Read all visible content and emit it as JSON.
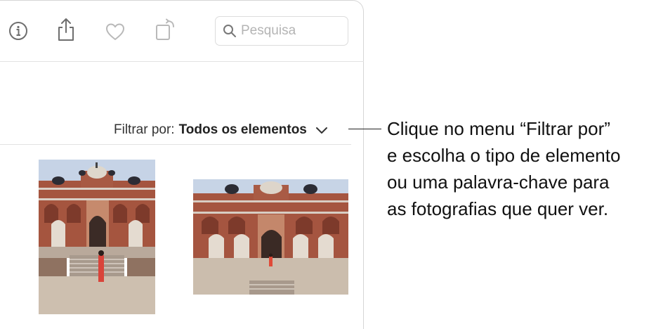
{
  "toolbar": {
    "icons": [
      "info-icon",
      "share-icon",
      "heart-icon",
      "rotate-icon"
    ],
    "search": {
      "placeholder": "Pesquisa",
      "value": ""
    }
  },
  "filter": {
    "label": "Filtrar por:",
    "value": "Todos os elementos"
  },
  "photos": [
    {
      "name": "portrait-monument-photo"
    },
    {
      "name": "landscape-monument-photo"
    }
  ],
  "callout": {
    "lines": [
      "Clique no menu “Filtrar por”",
      "e escolha o tipo de elemento",
      "ou uma palavra-chave para",
      "as fotografias que quer ver."
    ]
  },
  "colors": {
    "icon_gray": "#7a7a7a",
    "icon_light": "#bdbdbd",
    "sky": "#c8d4e3",
    "sandstone": "#a8543f",
    "ground": "#cdbfb0"
  }
}
